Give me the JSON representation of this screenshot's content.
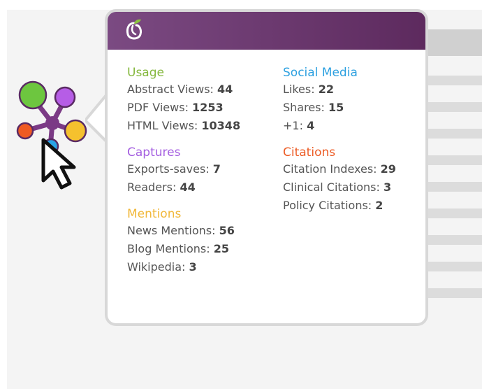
{
  "colors": {
    "header": "#6b3870",
    "usage": "#85b83e",
    "captures": "#a45ee0",
    "mentions": "#f1b83a",
    "social": "#2ca0e0",
    "citations": "#ec5b24"
  },
  "icons": {
    "logo": "plum-logo-icon",
    "badge": "plumx-flower-icon",
    "cursor": "mouse-pointer-icon"
  },
  "usage": {
    "title": "Usage",
    "rows": [
      {
        "label": "Abstract Views:",
        "value": "44"
      },
      {
        "label": "PDF Views:",
        "value": "1253"
      },
      {
        "label": "HTML Views:",
        "value": "10348"
      }
    ]
  },
  "captures": {
    "title": "Captures",
    "rows": [
      {
        "label": "Exports-saves:",
        "value": "7"
      },
      {
        "label": "Readers:",
        "value": "44"
      }
    ]
  },
  "mentions": {
    "title": "Mentions",
    "rows": [
      {
        "label": "News Mentions:",
        "value": "56"
      },
      {
        "label": "Blog Mentions:",
        "value": "25"
      },
      {
        "label": "Wikipedia:",
        "value": "3"
      }
    ]
  },
  "social": {
    "title": "Social Media",
    "rows": [
      {
        "label": "Likes:",
        "value": "22"
      },
      {
        "label": "Shares:",
        "value": "15"
      },
      {
        "label": "+1:",
        "value": "4"
      }
    ]
  },
  "citations": {
    "title": "Citations",
    "rows": [
      {
        "label": "Citation Indexes:",
        "value": "29"
      },
      {
        "label": "Clinical Citations:",
        "value": "3"
      },
      {
        "label": "Policy Citations:",
        "value": "2"
      }
    ]
  }
}
